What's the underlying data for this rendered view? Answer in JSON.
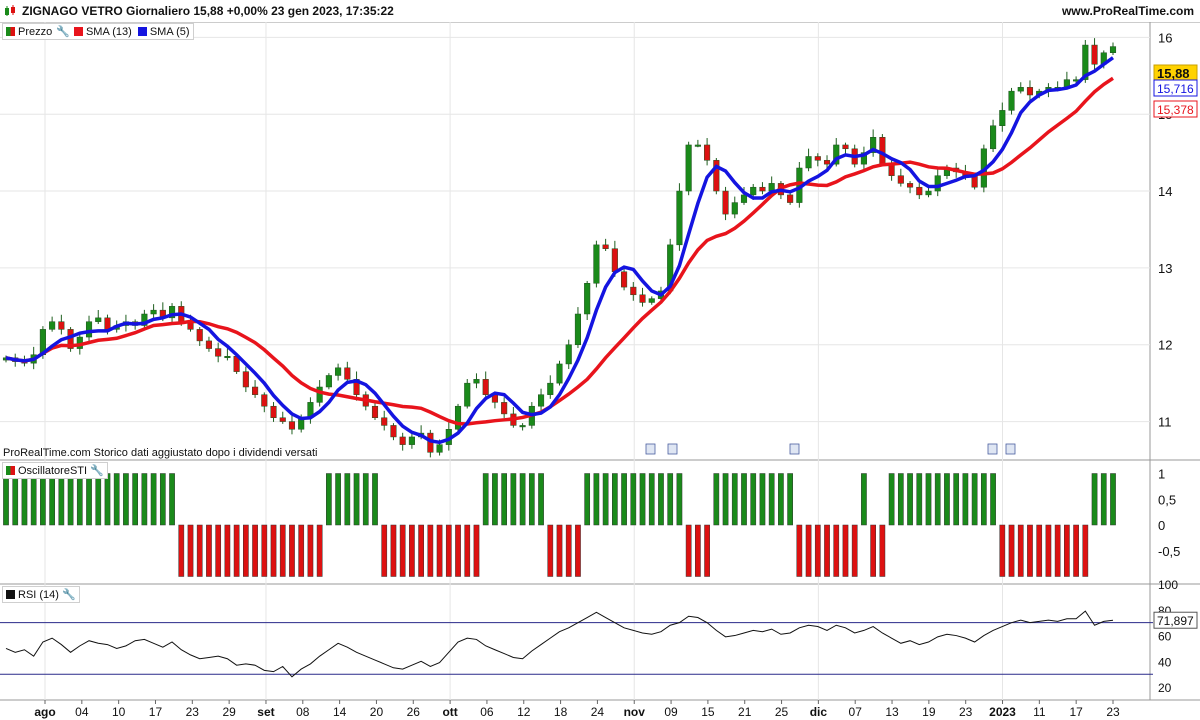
{
  "header": {
    "title": "ZIGNAGO VETRO Giornaliero 15,88 +0,00% 23 gen 2023, 17:35:22",
    "site": "www.ProRealTime.com"
  },
  "legend": {
    "price": "Prezzo",
    "sma13": "SMA (13)",
    "sma5": "SMA (5)",
    "oscillator": "OscillatoreSTI",
    "rsi": "RSI (14)"
  },
  "note": "ProRealTime.com Storico dati aggiustato dopo i dividendi versati",
  "colors": {
    "up": "#1a8a1a",
    "down": "#dd1111",
    "sma13": "#e8141c",
    "sma5": "#1414e0",
    "price_tag": "#ffd200",
    "rsi_line": "#111111",
    "rsi_levels": "#2a2a8a"
  },
  "chart_data": [
    {
      "type": "candlestick",
      "title": "ZIGNAGO VETRO Giornaliero",
      "ylim": [
        10.5,
        16.2
      ],
      "y_ticks": [
        "11",
        "12",
        "13",
        "14",
        "15",
        "16"
      ],
      "tags": [
        "15,88",
        "15,716",
        "15,378"
      ],
      "x_ticks": [
        "ago",
        "04",
        "10",
        "17",
        "23",
        "29",
        "set",
        "08",
        "14",
        "20",
        "26",
        "ott",
        "06",
        "12",
        "18",
        "24",
        "nov",
        "09",
        "15",
        "21",
        "25",
        "dic",
        "07",
        "13",
        "19",
        "23",
        "2023",
        "11",
        "17",
        "23"
      ],
      "close": [
        11.83,
        11.78,
        11.76,
        11.87,
        12.2,
        12.3,
        12.2,
        11.95,
        12.1,
        12.3,
        12.35,
        12.2,
        12.25,
        12.3,
        12.25,
        12.4,
        12.45,
        12.35,
        12.5,
        12.3,
        12.2,
        12.05,
        11.95,
        11.85,
        11.85,
        11.65,
        11.45,
        11.35,
        11.2,
        11.05,
        11.0,
        10.9,
        11.05,
        11.25,
        11.45,
        11.6,
        11.7,
        11.55,
        11.35,
        11.2,
        11.05,
        10.95,
        10.8,
        10.7,
        10.8,
        10.85,
        10.6,
        10.7,
        10.9,
        11.2,
        11.5,
        11.55,
        11.35,
        11.25,
        11.1,
        10.95,
        10.95,
        11.2,
        11.35,
        11.5,
        11.75,
        12.0,
        12.4,
        12.8,
        13.3,
        13.25,
        12.95,
        12.75,
        12.65,
        12.55,
        12.6,
        12.7,
        13.3,
        14.0,
        14.6,
        14.6,
        14.4,
        14.0,
        13.7,
        13.85,
        13.95,
        14.05,
        14.0,
        14.1,
        13.95,
        13.85,
        14.3,
        14.45,
        14.4,
        14.35,
        14.6,
        14.55,
        14.35,
        14.5,
        14.7,
        14.35,
        14.2,
        14.1,
        14.05,
        13.95,
        14.0,
        14.2,
        14.3,
        14.25,
        14.2,
        14.05,
        14.55,
        14.85,
        15.05,
        15.3,
        15.35,
        15.25,
        15.3,
        15.35,
        15.35,
        15.45,
        15.45,
        15.9,
        15.65,
        15.8,
        15.88
      ],
      "sma13_last": 15.378,
      "sma5_last": 15.716
    },
    {
      "type": "bar",
      "title": "OscillatoreSTI",
      "ylim": [
        -1,
        1
      ],
      "y_ticks": [
        "1",
        "0,5",
        "0",
        "-0,5"
      ],
      "values": [
        1,
        1,
        1,
        1,
        1,
        1,
        1,
        1,
        1,
        1,
        1,
        1,
        1,
        1,
        1,
        1,
        1,
        1,
        1,
        -1,
        -1,
        -1,
        -1,
        -1,
        -1,
        -1,
        -1,
        -1,
        -1,
        -1,
        -1,
        -1,
        -1,
        -1,
        -1,
        1,
        1,
        1,
        1,
        1,
        1,
        -1,
        -1,
        -1,
        -1,
        -1,
        -1,
        -1,
        -1,
        -1,
        -1,
        -1,
        1,
        1,
        1,
        1,
        1,
        1,
        1,
        -1,
        -1,
        -1,
        -1,
        1,
        1,
        1,
        1,
        1,
        1,
        1,
        1,
        1,
        1,
        1,
        -1,
        -1,
        -1,
        1,
        1,
        1,
        1,
        1,
        1,
        1,
        1,
        1,
        -1,
        -1,
        -1,
        -1,
        -1,
        -1,
        -1,
        1,
        -1,
        -1,
        1,
        1,
        1,
        1,
        1,
        1,
        1,
        1,
        1,
        1,
        1,
        1,
        -1,
        -1,
        -1,
        -1,
        -1,
        -1,
        -1,
        -1,
        -1,
        -1,
        1,
        1,
        1,
        1,
        1,
        1,
        1,
        1,
        1,
        1,
        1,
        1,
        1,
        1,
        1,
        1,
        1,
        1
      ]
    },
    {
      "type": "line",
      "title": "RSI (14)",
      "ylim": [
        10,
        100
      ],
      "y_ticks": [
        "100",
        "80",
        "60",
        "40",
        "20"
      ],
      "levels": [
        70,
        30
      ],
      "last_label": "71,897",
      "values": [
        50,
        47,
        49,
        44,
        55,
        58,
        53,
        47,
        52,
        56,
        54,
        53,
        50,
        52,
        56,
        57,
        54,
        51,
        55,
        49,
        45,
        42,
        43,
        44,
        42,
        37,
        38,
        37,
        33,
        32,
        36,
        28,
        34,
        38,
        44,
        49,
        54,
        51,
        47,
        44,
        41,
        38,
        35,
        34,
        37,
        40,
        36,
        39,
        47,
        55,
        58,
        57,
        52,
        49,
        46,
        43,
        42,
        48,
        53,
        58,
        63,
        66,
        70,
        74,
        78,
        74,
        70,
        66,
        64,
        62,
        61,
        63,
        68,
        70,
        75,
        74,
        70,
        64,
        59,
        60,
        62,
        64,
        63,
        65,
        61,
        62,
        66,
        68,
        67,
        64,
        68,
        66,
        62,
        64,
        67,
        62,
        58,
        54,
        56,
        53,
        55,
        59,
        61,
        60,
        58,
        55,
        60,
        64,
        67,
        70,
        72,
        70,
        71,
        72,
        71,
        73,
        73,
        79,
        68,
        71,
        71.897
      ]
    }
  ]
}
